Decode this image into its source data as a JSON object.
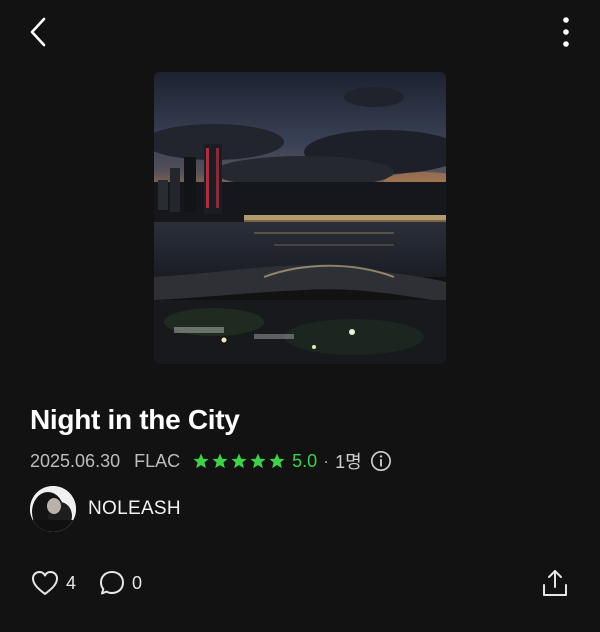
{
  "header": {
    "back_icon": "chevron-left-icon",
    "more_icon": "vertical-dots-icon"
  },
  "track": {
    "title": "Night in the City",
    "date": "2025.06.30",
    "format": "FLAC",
    "rating_stars": 5,
    "rating": "5.0",
    "separator": "·",
    "rating_count": "1명",
    "info_icon": "info-icon"
  },
  "artist": {
    "name": "NOLEASH",
    "avatar_icon": "avatar"
  },
  "actions": {
    "likes": "4",
    "comments": "0",
    "like_icon": "heart-icon",
    "comment_icon": "comment-bubble-icon",
    "share_icon": "share-upload-icon"
  },
  "colors": {
    "background": "#121212",
    "accent_green": "#3fd14a",
    "text_secondary": "#bdbdbd"
  }
}
